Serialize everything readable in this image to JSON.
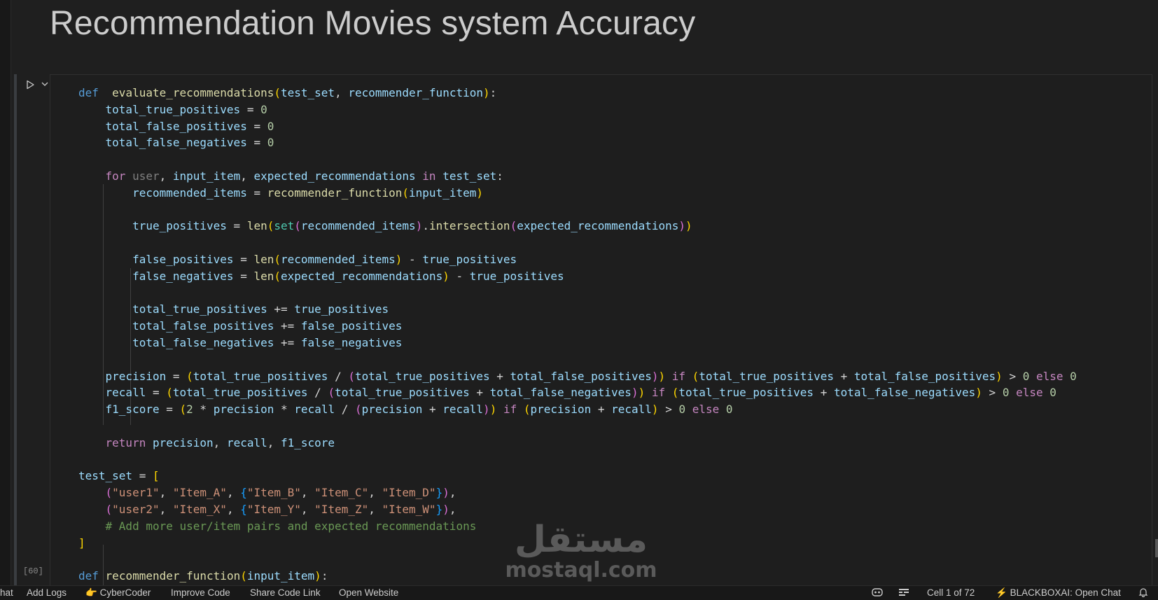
{
  "markdown": {
    "title": "Recommendation Movies system Accuracy"
  },
  "cell": {
    "execution_count": "[60]"
  },
  "code_lines": [
    [
      [
        "kw",
        "def"
      ],
      [
        "",
        "  "
      ],
      [
        "fn",
        "evaluate_recommendations"
      ],
      [
        "b1",
        "("
      ],
      [
        "var",
        "test_set"
      ],
      [
        "",
        ", "
      ],
      [
        "var",
        "recommender_function"
      ],
      [
        "b1",
        ")"
      ],
      [
        "",
        ":"
      ]
    ],
    [
      [
        "",
        "    "
      ],
      [
        "var",
        "total_true_positives"
      ],
      [
        "",
        " = "
      ],
      [
        "num",
        "0"
      ]
    ],
    [
      [
        "",
        "    "
      ],
      [
        "var",
        "total_false_positives"
      ],
      [
        "",
        " = "
      ],
      [
        "num",
        "0"
      ]
    ],
    [
      [
        "",
        "    "
      ],
      [
        "var",
        "total_false_negatives"
      ],
      [
        "",
        " = "
      ],
      [
        "num",
        "0"
      ]
    ],
    [],
    [
      [
        "",
        "    "
      ],
      [
        "ctl",
        "for"
      ],
      [
        "",
        " "
      ],
      [
        "dim",
        "user"
      ],
      [
        "",
        ", "
      ],
      [
        "var",
        "input_item"
      ],
      [
        "",
        ", "
      ],
      [
        "var",
        "expected_recommendations"
      ],
      [
        "",
        " "
      ],
      [
        "ctl",
        "in"
      ],
      [
        "",
        " "
      ],
      [
        "var",
        "test_set"
      ],
      [
        "",
        ":"
      ]
    ],
    [
      [
        "",
        "        "
      ],
      [
        "var",
        "recommended_items"
      ],
      [
        "",
        " = "
      ],
      [
        "fn",
        "recommender_function"
      ],
      [
        "b1",
        "("
      ],
      [
        "var",
        "input_item"
      ],
      [
        "b1",
        ")"
      ]
    ],
    [],
    [
      [
        "",
        "        "
      ],
      [
        "var",
        "true_positives"
      ],
      [
        "",
        " = "
      ],
      [
        "fn",
        "len"
      ],
      [
        "b1",
        "("
      ],
      [
        "bi",
        "set"
      ],
      [
        "b2",
        "("
      ],
      [
        "var",
        "recommended_items"
      ],
      [
        "b2",
        ")"
      ],
      [
        "",
        "."
      ],
      [
        "fn",
        "intersection"
      ],
      [
        "b2",
        "("
      ],
      [
        "var",
        "expected_recommendations"
      ],
      [
        "b2",
        ")"
      ],
      [
        "b1",
        ")"
      ]
    ],
    [],
    [
      [
        "",
        "        "
      ],
      [
        "var",
        "false_positives"
      ],
      [
        "",
        " = "
      ],
      [
        "fn",
        "len"
      ],
      [
        "b1",
        "("
      ],
      [
        "var",
        "recommended_items"
      ],
      [
        "b1",
        ")"
      ],
      [
        "",
        " - "
      ],
      [
        "var",
        "true_positives"
      ]
    ],
    [
      [
        "",
        "        "
      ],
      [
        "var",
        "false_negatives"
      ],
      [
        "",
        " = "
      ],
      [
        "fn",
        "len"
      ],
      [
        "b1",
        "("
      ],
      [
        "var",
        "expected_recommendations"
      ],
      [
        "b1",
        ")"
      ],
      [
        "",
        " - "
      ],
      [
        "var",
        "true_positives"
      ]
    ],
    [],
    [
      [
        "",
        "        "
      ],
      [
        "var",
        "total_true_positives"
      ],
      [
        "",
        " += "
      ],
      [
        "var",
        "true_positives"
      ]
    ],
    [
      [
        "",
        "        "
      ],
      [
        "var",
        "total_false_positives"
      ],
      [
        "",
        " += "
      ],
      [
        "var",
        "false_positives"
      ]
    ],
    [
      [
        "",
        "        "
      ],
      [
        "var",
        "total_false_negatives"
      ],
      [
        "",
        " += "
      ],
      [
        "var",
        "false_negatives"
      ]
    ],
    [],
    [
      [
        "",
        "    "
      ],
      [
        "var",
        "precision"
      ],
      [
        "",
        " = "
      ],
      [
        "b1",
        "("
      ],
      [
        "var",
        "total_true_positives"
      ],
      [
        "",
        " / "
      ],
      [
        "b2",
        "("
      ],
      [
        "var",
        "total_true_positives"
      ],
      [
        "",
        " + "
      ],
      [
        "var",
        "total_false_positives"
      ],
      [
        "b2",
        ")"
      ],
      [
        "b1",
        ")"
      ],
      [
        "",
        " "
      ],
      [
        "ctl",
        "if"
      ],
      [
        "",
        " "
      ],
      [
        "b1",
        "("
      ],
      [
        "var",
        "total_true_positives"
      ],
      [
        "",
        " + "
      ],
      [
        "var",
        "total_false_positives"
      ],
      [
        "b1",
        ")"
      ],
      [
        "",
        " > "
      ],
      [
        "num",
        "0"
      ],
      [
        "",
        " "
      ],
      [
        "ctl",
        "else"
      ],
      [
        "",
        " "
      ],
      [
        "num",
        "0"
      ]
    ],
    [
      [
        "",
        "    "
      ],
      [
        "var",
        "recall"
      ],
      [
        "",
        " = "
      ],
      [
        "b1",
        "("
      ],
      [
        "var",
        "total_true_positives"
      ],
      [
        "",
        " / "
      ],
      [
        "b2",
        "("
      ],
      [
        "var",
        "total_true_positives"
      ],
      [
        "",
        " + "
      ],
      [
        "var",
        "total_false_negatives"
      ],
      [
        "b2",
        ")"
      ],
      [
        "b1",
        ")"
      ],
      [
        "",
        " "
      ],
      [
        "ctl",
        "if"
      ],
      [
        "",
        " "
      ],
      [
        "b1",
        "("
      ],
      [
        "var",
        "total_true_positives"
      ],
      [
        "",
        " + "
      ],
      [
        "var",
        "total_false_negatives"
      ],
      [
        "b1",
        ")"
      ],
      [
        "",
        " > "
      ],
      [
        "num",
        "0"
      ],
      [
        "",
        " "
      ],
      [
        "ctl",
        "else"
      ],
      [
        "",
        " "
      ],
      [
        "num",
        "0"
      ]
    ],
    [
      [
        "",
        "    "
      ],
      [
        "var",
        "f1_score"
      ],
      [
        "",
        " = "
      ],
      [
        "b1",
        "("
      ],
      [
        "num",
        "2"
      ],
      [
        "",
        " * "
      ],
      [
        "var",
        "precision"
      ],
      [
        "",
        " * "
      ],
      [
        "var",
        "recall"
      ],
      [
        "",
        " / "
      ],
      [
        "b2",
        "("
      ],
      [
        "var",
        "precision"
      ],
      [
        "",
        " + "
      ],
      [
        "var",
        "recall"
      ],
      [
        "b2",
        ")"
      ],
      [
        "b1",
        ")"
      ],
      [
        "",
        " "
      ],
      [
        "ctl",
        "if"
      ],
      [
        "",
        " "
      ],
      [
        "b1",
        "("
      ],
      [
        "var",
        "precision"
      ],
      [
        "",
        " + "
      ],
      [
        "var",
        "recall"
      ],
      [
        "b1",
        ")"
      ],
      [
        "",
        " > "
      ],
      [
        "num",
        "0"
      ],
      [
        "",
        " "
      ],
      [
        "ctl",
        "else"
      ],
      [
        "",
        " "
      ],
      [
        "num",
        "0"
      ]
    ],
    [],
    [
      [
        "",
        "    "
      ],
      [
        "ctl",
        "return"
      ],
      [
        "",
        " "
      ],
      [
        "var",
        "precision"
      ],
      [
        "",
        ", "
      ],
      [
        "var",
        "recall"
      ],
      [
        "",
        ", "
      ],
      [
        "var",
        "f1_score"
      ]
    ],
    [],
    [
      [
        "var",
        "test_set"
      ],
      [
        "",
        " = "
      ],
      [
        "b1",
        "["
      ]
    ],
    [
      [
        "",
        "    "
      ],
      [
        "b2",
        "("
      ],
      [
        "str",
        "\"user1\""
      ],
      [
        "",
        ", "
      ],
      [
        "str",
        "\"Item_A\""
      ],
      [
        "",
        ", "
      ],
      [
        "b3",
        "{"
      ],
      [
        "str",
        "\"Item_B\""
      ],
      [
        "",
        ", "
      ],
      [
        "str",
        "\"Item_C\""
      ],
      [
        "",
        ", "
      ],
      [
        "str",
        "\"Item_D\""
      ],
      [
        "b3",
        "}"
      ],
      [
        "b2",
        ")"
      ],
      [
        "",
        ","
      ]
    ],
    [
      [
        "",
        "    "
      ],
      [
        "b2",
        "("
      ],
      [
        "str",
        "\"user2\""
      ],
      [
        "",
        ", "
      ],
      [
        "str",
        "\"Item_X\""
      ],
      [
        "",
        ", "
      ],
      [
        "b3",
        "{"
      ],
      [
        "str",
        "\"Item_Y\""
      ],
      [
        "",
        ", "
      ],
      [
        "str",
        "\"Item_Z\""
      ],
      [
        "",
        ", "
      ],
      [
        "str",
        "\"Item_W\""
      ],
      [
        "b3",
        "}"
      ],
      [
        "b2",
        ")"
      ],
      [
        "",
        ","
      ]
    ],
    [
      [
        "",
        "    "
      ],
      [
        "cmt",
        "# Add more user/item pairs and expected recommendations"
      ]
    ],
    [
      [
        "b1",
        "]"
      ]
    ],
    [],
    [
      [
        "kw",
        "def"
      ],
      [
        "",
        " "
      ],
      [
        "fn",
        "recommender_function"
      ],
      [
        "b1",
        "("
      ],
      [
        "var",
        "input_item"
      ],
      [
        "b1",
        ")"
      ],
      [
        "",
        ":"
      ]
    ]
  ],
  "watermark": {
    "arabic": "مستقل",
    "latin": "mostaql.com"
  },
  "status_bar": {
    "left": [
      "hat",
      "Add Logs",
      "CyberCoder",
      "Improve Code",
      "Share Code Link",
      "Open Website"
    ],
    "cell_position": "Cell 1 of 72",
    "blackbox": "BLACKBOXAI: Open Chat"
  },
  "colors": {
    "background": "#1f1f1f",
    "editor": "#1e1e1e",
    "keyword": "#569cd6",
    "function": "#dcdcaa",
    "variable": "#9cdcfe",
    "string": "#ce9178",
    "comment": "#6a9955"
  },
  "icons": [
    "run-cell-icon",
    "chevron-down-icon",
    "thumbs-up-icon",
    "copilot-icon",
    "indent-icon",
    "lightning-icon",
    "bell-icon"
  ]
}
